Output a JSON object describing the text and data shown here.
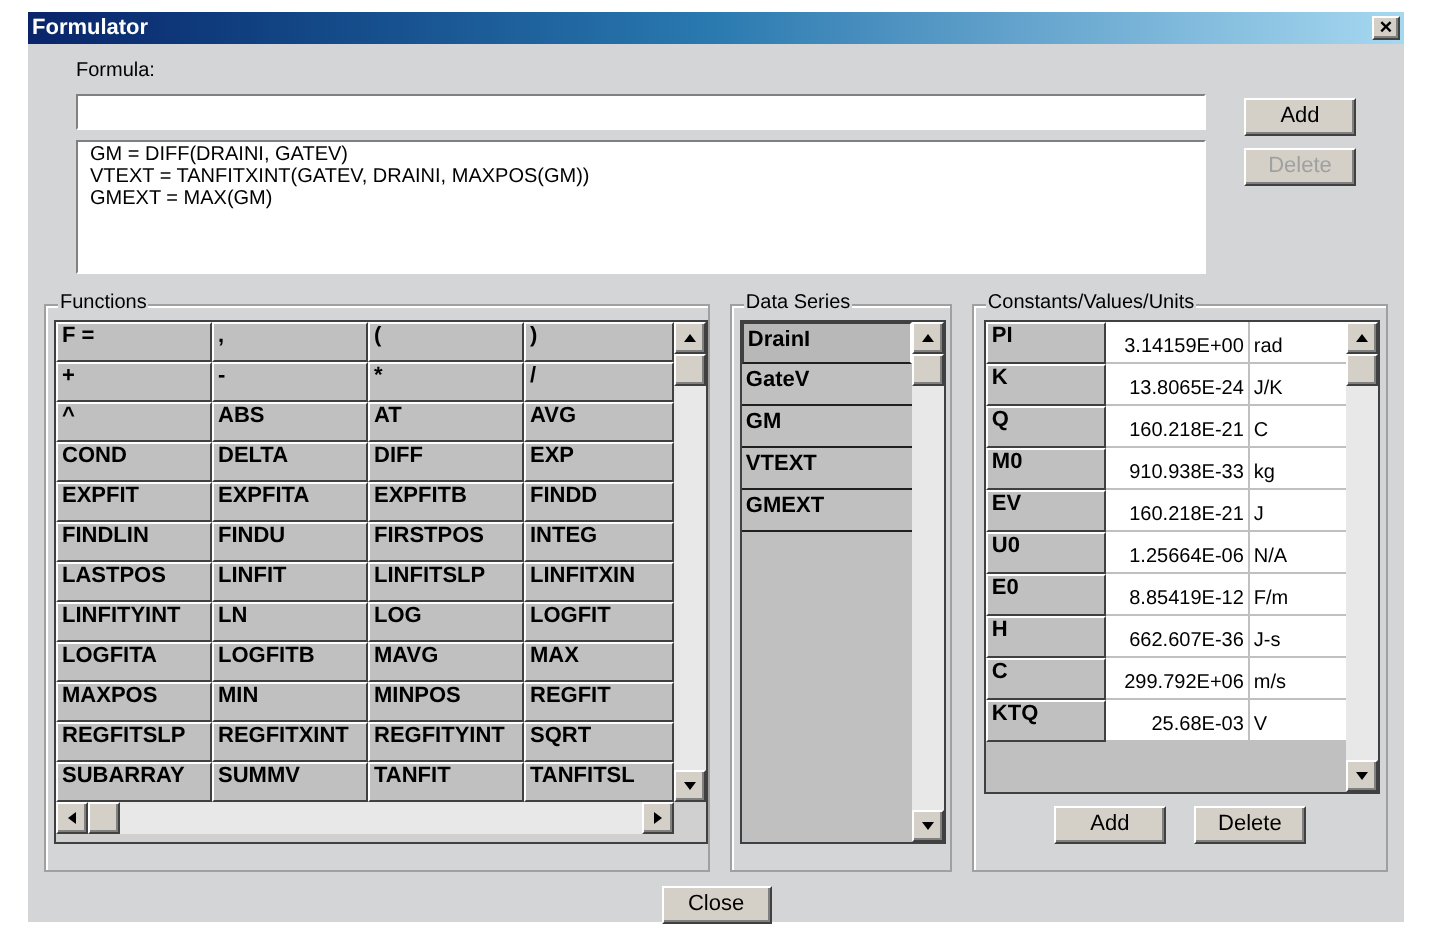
{
  "window": {
    "title": "Formulator",
    "close": "×"
  },
  "formula": {
    "label": "Formula:",
    "lines": [
      "GM = DIFF(DRAINI, GATEV)",
      "VTEXT = TANFITXINT(GATEV, DRAINI, MAXPOS(GM))",
      "GMEXT = MAX(GM)"
    ]
  },
  "formula_buttons": [
    {
      "label": "Add",
      "disabled": false
    },
    {
      "label": "Delete",
      "disabled": true
    }
  ],
  "functions": {
    "title": "Functions",
    "rows": [
      [
        "F =",
        ",",
        "(",
        ")"
      ],
      [
        "+",
        "-",
        "*",
        "/"
      ],
      [
        "^",
        "ABS",
        "AT",
        "AVG"
      ],
      [
        "COND",
        "DELTA",
        "DIFF",
        "EXP"
      ],
      [
        "EXPFIT",
        "EXPFITA",
        "EXPFITB",
        "FINDD"
      ],
      [
        "FINDLIN",
        "FINDU",
        "FIRSTPOS",
        "INTEG"
      ],
      [
        "LASTPOS",
        "LINFIT",
        "LINFITSLP",
        "LINFITXIN"
      ],
      [
        "LINFITYINT",
        "LN",
        "LOG",
        "LOGFIT"
      ],
      [
        "LOGFITA",
        "LOGFITB",
        "MAVG",
        "MAX"
      ],
      [
        "MAXPOS",
        "MIN",
        "MINPOS",
        "REGFIT"
      ],
      [
        "REGFITSLP",
        "REGFITXINT",
        "REGFITYINT",
        "SQRT"
      ],
      [
        "SUBARRAY",
        "SUMMV",
        "TANFIT",
        "TANFITSL"
      ]
    ]
  },
  "data_series": {
    "title": "Data Series",
    "items": [
      {
        "label": "DrainI",
        "selected": true
      },
      {
        "label": "GateV",
        "selected": false
      },
      {
        "label": "GM",
        "selected": false
      },
      {
        "label": "VTEXT",
        "selected": false
      },
      {
        "label": "GMEXT",
        "selected": false
      }
    ]
  },
  "constants": {
    "title": "Constants/Values/Units",
    "rows": [
      {
        "name": "PI",
        "value": "3.14159E+00",
        "unit": "rad"
      },
      {
        "name": "K",
        "value": "13.8065E-24",
        "unit": "J/K"
      },
      {
        "name": "Q",
        "value": "160.218E-21",
        "unit": "C"
      },
      {
        "name": "M0",
        "value": "910.938E-33",
        "unit": "kg"
      },
      {
        "name": "EV",
        "value": "160.218E-21",
        "unit": "J"
      },
      {
        "name": "U0",
        "value": "1.25664E-06",
        "unit": "N/A"
      },
      {
        "name": "E0",
        "value": "8.85419E-12",
        "unit": "F/m"
      },
      {
        "name": "H",
        "value": "662.607E-36",
        "unit": "J-s"
      },
      {
        "name": "C",
        "value": "299.792E+06",
        "unit": "m/s"
      },
      {
        "name": "KTQ",
        "value": "25.68E-03",
        "unit": "V"
      }
    ],
    "buttons": [
      "Add",
      "Delete"
    ]
  },
  "close_button": "Close"
}
